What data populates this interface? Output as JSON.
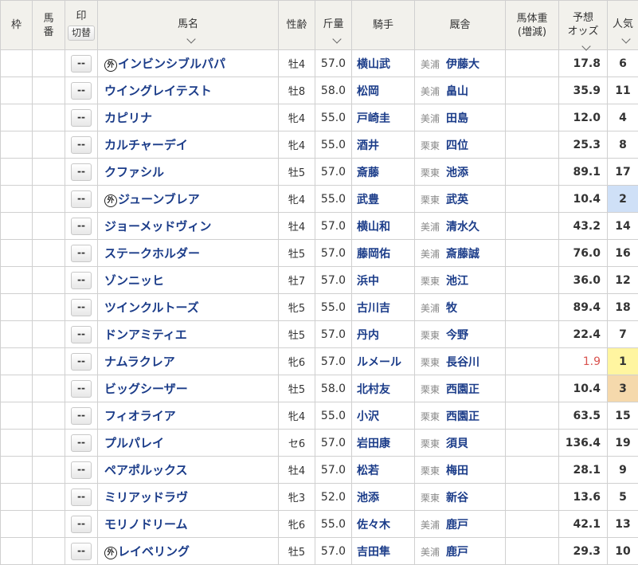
{
  "header": {
    "waku": "枠",
    "umaban_1": "馬",
    "umaban_2": "番",
    "mark": "印",
    "mark_toggle": "切替",
    "horse_name": "馬名",
    "sex_age": "性齢",
    "weight": "斤量",
    "jockey": "騎手",
    "stable": "厩舎",
    "body_weight_1": "馬体重",
    "body_weight_2": "(増減)",
    "odds_1": "予想",
    "odds_2": "オッズ",
    "popularity_1": "人",
    "popularity_2": "気"
  },
  "foreign_mark": "外",
  "rows": [
    {
      "mark": "--",
      "foreign": true,
      "name": "インビンシブルパパ",
      "sex": "牡4",
      "weight": "57.0",
      "jockey": "横山武",
      "region": "美浦",
      "trainer": "伊藤大",
      "odds": "17.8",
      "pop": "6"
    },
    {
      "mark": "--",
      "foreign": false,
      "name": "ウイングレイテスト",
      "sex": "牡8",
      "weight": "58.0",
      "jockey": "松岡",
      "region": "美浦",
      "trainer": "畠山",
      "odds": "35.9",
      "pop": "11"
    },
    {
      "mark": "--",
      "foreign": false,
      "name": "カピリナ",
      "sex": "牝4",
      "weight": "55.0",
      "jockey": "戸崎圭",
      "region": "美浦",
      "trainer": "田島",
      "odds": "12.0",
      "pop": "4"
    },
    {
      "mark": "--",
      "foreign": false,
      "name": "カルチャーデイ",
      "sex": "牝4",
      "weight": "55.0",
      "jockey": "酒井",
      "region": "栗東",
      "trainer": "四位",
      "odds": "25.3",
      "pop": "8"
    },
    {
      "mark": "--",
      "foreign": false,
      "name": "クファシル",
      "sex": "牡5",
      "weight": "57.0",
      "jockey": "斎藤",
      "region": "栗東",
      "trainer": "池添",
      "odds": "89.1",
      "pop": "17"
    },
    {
      "mark": "--",
      "foreign": true,
      "name": "ジューンブレア",
      "sex": "牝4",
      "weight": "55.0",
      "jockey": "武豊",
      "region": "栗東",
      "trainer": "武英",
      "odds": "10.4",
      "pop": "2"
    },
    {
      "mark": "--",
      "foreign": false,
      "name": "ジョーメッドヴィン",
      "sex": "牡4",
      "weight": "57.0",
      "jockey": "横山和",
      "region": "美浦",
      "trainer": "清水久",
      "odds": "43.2",
      "pop": "14"
    },
    {
      "mark": "--",
      "foreign": false,
      "name": "ステークホルダー",
      "sex": "牡5",
      "weight": "57.0",
      "jockey": "藤岡佑",
      "region": "美浦",
      "trainer": "斎藤誠",
      "odds": "76.0",
      "pop": "16"
    },
    {
      "mark": "--",
      "foreign": false,
      "name": "ゾンニッヒ",
      "sex": "牡7",
      "weight": "57.0",
      "jockey": "浜中",
      "region": "栗東",
      "trainer": "池江",
      "odds": "36.0",
      "pop": "12"
    },
    {
      "mark": "--",
      "foreign": false,
      "name": "ツインクルトーズ",
      "sex": "牝5",
      "weight": "55.0",
      "jockey": "古川吉",
      "region": "美浦",
      "trainer": "牧",
      "odds": "89.4",
      "pop": "18"
    },
    {
      "mark": "--",
      "foreign": false,
      "name": "ドンアミティエ",
      "sex": "牡5",
      "weight": "57.0",
      "jockey": "丹内",
      "region": "栗東",
      "trainer": "今野",
      "odds": "22.4",
      "pop": "7"
    },
    {
      "mark": "--",
      "foreign": false,
      "name": "ナムラクレア",
      "sex": "牝6",
      "weight": "57.0",
      "jockey": "ルメール",
      "region": "栗東",
      "trainer": "長谷川",
      "odds": "1.9",
      "pop": "1"
    },
    {
      "mark": "--",
      "foreign": false,
      "name": "ビッグシーザー",
      "sex": "牡5",
      "weight": "58.0",
      "jockey": "北村友",
      "region": "栗東",
      "trainer": "西園正",
      "odds": "10.4",
      "pop": "3"
    },
    {
      "mark": "--",
      "foreign": false,
      "name": "フィオライア",
      "sex": "牝4",
      "weight": "55.0",
      "jockey": "小沢",
      "region": "栗東",
      "trainer": "西園正",
      "odds": "63.5",
      "pop": "15"
    },
    {
      "mark": "--",
      "foreign": false,
      "name": "プルパレイ",
      "sex": "セ6",
      "weight": "57.0",
      "jockey": "岩田康",
      "region": "栗東",
      "trainer": "須貝",
      "odds": "136.4",
      "pop": "19"
    },
    {
      "mark": "--",
      "foreign": false,
      "name": "ペアポルックス",
      "sex": "牡4",
      "weight": "57.0",
      "jockey": "松若",
      "region": "栗東",
      "trainer": "梅田",
      "odds": "28.1",
      "pop": "9"
    },
    {
      "mark": "--",
      "foreign": false,
      "name": "ミリアッドラヴ",
      "sex": "牝3",
      "weight": "52.0",
      "jockey": "池添",
      "region": "栗東",
      "trainer": "新谷",
      "odds": "13.6",
      "pop": "5"
    },
    {
      "mark": "--",
      "foreign": false,
      "name": "モリノドリーム",
      "sex": "牝6",
      "weight": "55.0",
      "jockey": "佐々木",
      "region": "美浦",
      "trainer": "鹿戸",
      "odds": "42.1",
      "pop": "13"
    },
    {
      "mark": "--",
      "foreign": true,
      "name": "レイベリング",
      "sex": "牡5",
      "weight": "57.0",
      "jockey": "吉田隼",
      "region": "美浦",
      "trainer": "鹿戸",
      "odds": "29.3",
      "pop": "10"
    }
  ],
  "colors": {
    "link": "#1b3c89",
    "favorite_odds": "#d9534f",
    "pop1": "#fff5a0",
    "pop2": "#cfe0f7",
    "pop3": "#f5d9ac",
    "header_bg": "#f2f1ec"
  }
}
